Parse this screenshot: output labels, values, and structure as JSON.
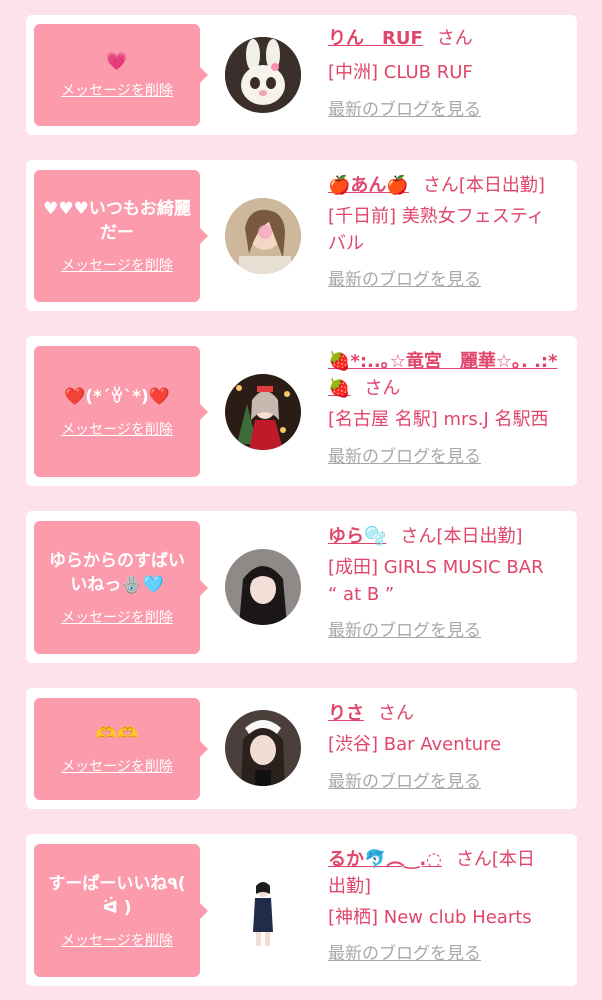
{
  "items": [
    {
      "message": "💗",
      "delete_label": "メッセージを削除",
      "name": "りん　RUF",
      "san": "さん",
      "tag": "",
      "shop_line1": "[中洲] CLUB RUF",
      "shop_line2": "",
      "blog": "最新のブログを見る"
    },
    {
      "message": "♥♥♥いつもお綺麗\nだー",
      "delete_label": "メッセージを削除",
      "name": "🍎あん🍎",
      "san": "さん",
      "tag": "[本日出勤]",
      "shop_line1": "[千日前] 美熟女フェスティ",
      "shop_line2": "バル",
      "blog": "最新のブログを見る"
    },
    {
      "message": "❤️(*´ꈊ`*)❤️",
      "delete_label": "メッセージを削除",
      "name": "🍓*:..｡☆竜宮　麗華☆｡. .:*",
      "name2": "🍓",
      "san": "さん",
      "tag": "",
      "shop_line1": "[名古屋 名駅] mrs.J 名駅西",
      "shop_line2": "",
      "blog": "最新のブログを見る"
    },
    {
      "message": "ゆらからのすばい\nいねっ🪬🩵",
      "delete_label": "メッセージを削除",
      "name": "ゆら🫧",
      "san": "さん",
      "tag": "[本日出勤]",
      "shop_line1": "[成田] GIRLS MUSIC BAR",
      "shop_line2": "“ at B ”",
      "blog": "最新のブログを見る"
    },
    {
      "message": "🫶🫶",
      "delete_label": "メッセージを削除",
      "name": "りさ",
      "san": "さん",
      "tag": "",
      "shop_line1": "[渋谷] Bar Aventure",
      "shop_line2": "",
      "blog": "最新のブログを見る"
    },
    {
      "message": "すーぱーいいね٩(\nᐛ )",
      "delete_label": "メッセージを削除",
      "name": "るか🐬︵‿.◌",
      "san": "さん",
      "tag": "[本日",
      "tag2": "出勤]",
      "shop_line1": "[神栖] New club Hearts",
      "shop_line2": "",
      "blog": "最新のブログを見る"
    }
  ]
}
